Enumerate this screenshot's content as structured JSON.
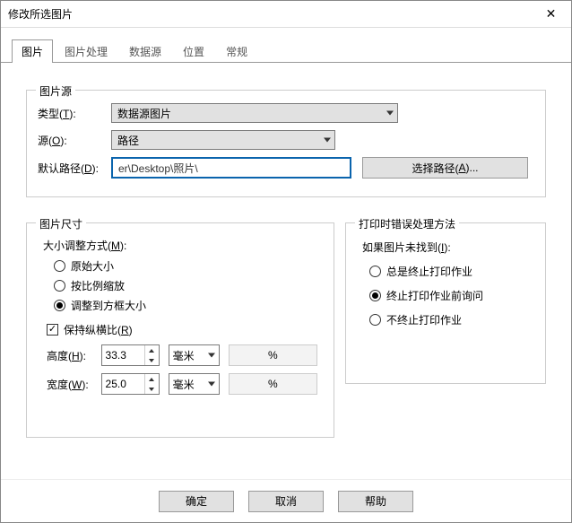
{
  "window": {
    "title": "修改所选图片"
  },
  "tabs": [
    "图片",
    "图片处理",
    "数据源",
    "位置",
    "常规"
  ],
  "source": {
    "legend": "图片源",
    "type_label_pre": "类型(",
    "type_label_u": "T",
    "type_label_post": "):",
    "type_value": "数据源图片",
    "src_label_pre": "源(",
    "src_label_u": "O",
    "src_label_post": "):",
    "src_value": "路径",
    "path_label_pre": "默认路径(",
    "path_label_u": "D",
    "path_label_post": "):",
    "path_value": "er\\Desktop\\照片\\",
    "choose_path_pre": "选择路径(",
    "choose_path_u": "A",
    "choose_path_post": ")..."
  },
  "size": {
    "legend": "图片尺寸",
    "resize_label_pre": "大小调整方式(",
    "resize_label_u": "M",
    "resize_label_post": "):",
    "opt_original": "原始大小",
    "opt_scale": "按比例缩放",
    "opt_fit": "调整到方框大小",
    "keep_ratio_pre": "保持纵横比(",
    "keep_ratio_u": "R",
    "keep_ratio_post": ")",
    "height_label_pre": "高度(",
    "height_label_u": "H",
    "height_label_post": "):",
    "height_value": "33.3",
    "width_label_pre": "宽度(",
    "width_label_u": "W",
    "width_label_post": "):",
    "width_value": "25.0",
    "unit": "毫米",
    "percent": "%"
  },
  "error": {
    "legend": "打印时错误处理方法",
    "heading_pre": "如果图片未找到(",
    "heading_u": "I",
    "heading_post": "):",
    "opt_always_stop": "总是终止打印作业",
    "opt_ask_stop": "终止打印作业前询问",
    "opt_no_stop": "不终止打印作业"
  },
  "footer": {
    "ok": "确定",
    "cancel": "取消",
    "help": "帮助"
  }
}
